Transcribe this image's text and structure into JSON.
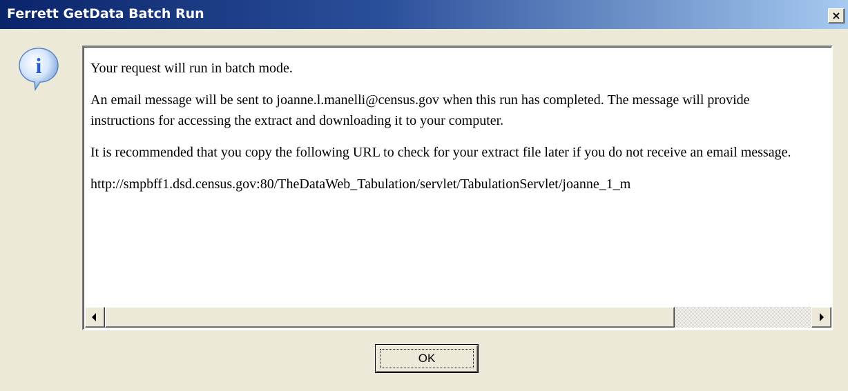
{
  "window": {
    "title": "Ferrett GetData Batch Run",
    "close_label": "×"
  },
  "icon": {
    "name": "info-icon",
    "glyph": "i",
    "color": "#2a5fc9"
  },
  "message": {
    "line1": "Your request will run in batch mode.",
    "para2": "An email message will be sent to joanne.l.manelli@census.gov when this run has completed. The message will provide instructions for accessing the extract and downloading it to your computer.",
    "para3": "It is recommended that you copy the following URL to check for your extract file later if you do not receive an email message.",
    "url": "http://smpbff1.dsd.census.gov:80/TheDataWeb_Tabulation/servlet/TabulationServlet/joanne_1_m"
  },
  "scrollbar": {
    "left_icon": "scroll-left-arrow-icon",
    "right_icon": "scroll-right-arrow-icon"
  },
  "buttons": {
    "ok_label": "OK"
  },
  "colors": {
    "titlebar_start": "#0a246a",
    "titlebar_end": "#a6caf0",
    "dialog_bg": "#ece9d8"
  }
}
